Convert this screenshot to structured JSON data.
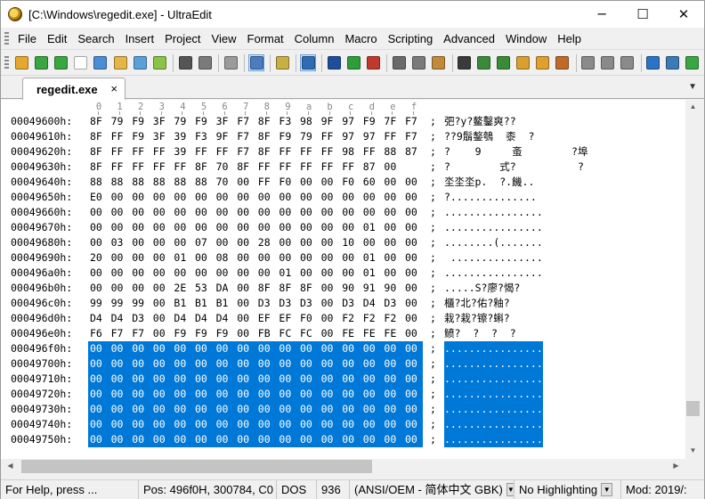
{
  "window": {
    "title": "[C:\\Windows\\regedit.exe] - UltraEdit",
    "minimize_glyph": "─",
    "maximize_glyph": "☐",
    "close_glyph": "✕"
  },
  "menu": [
    "File",
    "Edit",
    "Search",
    "Insert",
    "Project",
    "View",
    "Format",
    "Column",
    "Macro",
    "Scripting",
    "Advanced",
    "Window",
    "Help"
  ],
  "toolbar": {
    "icons": [
      {
        "name": "open-folder-icon",
        "color": "#e6a82e"
      },
      {
        "name": "back-arrow-icon",
        "color": "#3aa641"
      },
      {
        "name": "forward-arrow-icon",
        "color": "#3aa641"
      },
      {
        "name": "new-file-icon",
        "color": "#ffffff"
      },
      {
        "name": "open-file-icon",
        "color": "#4a8cd6"
      },
      {
        "name": "open-folder-2-icon",
        "color": "#e6b548"
      },
      {
        "name": "save-icon",
        "color": "#5aa0d8"
      },
      {
        "name": "save-all-icon",
        "color": "#8bc34a"
      },
      {
        "name": "sep"
      },
      {
        "name": "print-icon",
        "color": "#555555"
      },
      {
        "name": "print-preview-icon",
        "color": "#7a7a7a"
      },
      {
        "name": "sep"
      },
      {
        "name": "document-icon",
        "color": "#9a9a9a"
      },
      {
        "name": "sep"
      },
      {
        "name": "hex-mode-icon",
        "color": "#4a7dc0",
        "pressed": true
      },
      {
        "name": "sep"
      },
      {
        "name": "column-mode-icon",
        "color": "#c8b042"
      },
      {
        "name": "sep"
      },
      {
        "name": "word-wrap-icon",
        "color": "#2e6db5",
        "pressed": true
      },
      {
        "name": "sep"
      },
      {
        "name": "ftp-back-icon",
        "color": "#1f4f9c"
      },
      {
        "name": "ftp-up-icon",
        "color": "#2e9e3a"
      },
      {
        "name": "ftp-stop-icon",
        "color": "#c0392b"
      },
      {
        "name": "sep"
      },
      {
        "name": "cut-icon",
        "color": "#6a6a6a"
      },
      {
        "name": "copy-icon",
        "color": "#7a7a7a"
      },
      {
        "name": "paste-icon",
        "color": "#c08a3a"
      },
      {
        "name": "sep"
      },
      {
        "name": "find-icon",
        "color": "#3a3a3a"
      },
      {
        "name": "find-prev-icon",
        "color": "#3a8a3a"
      },
      {
        "name": "find-next-icon",
        "color": "#3a8a3a"
      },
      {
        "name": "replace-icon",
        "color": "#d8a02e"
      },
      {
        "name": "find-in-files-icon",
        "color": "#e0a030"
      },
      {
        "name": "replace-in-files-icon",
        "color": "#c06a2a"
      },
      {
        "name": "sep"
      },
      {
        "name": "list-icon",
        "color": "#8a8a8a"
      },
      {
        "name": "tile-icon",
        "color": "#8a8a8a"
      },
      {
        "name": "cascade-icon",
        "color": "#8a8a8a"
      },
      {
        "name": "sep"
      },
      {
        "name": "browser-icon",
        "color": "#2d73c4"
      },
      {
        "name": "spell-icon",
        "color": "#3a7ab8"
      },
      {
        "name": "refresh-icon",
        "color": "#3aa641"
      }
    ]
  },
  "tab": {
    "label": "regedit.exe",
    "close": "×",
    "menu_arrow": "▼"
  },
  "ruler": [
    "0",
    "1",
    "2",
    "3",
    "4",
    "5",
    "6",
    "7",
    "8",
    "9",
    "a",
    "b",
    "c",
    "d",
    "e",
    "f"
  ],
  "rows": [
    {
      "addr": "00049600h:",
      "bytes": [
        "8F",
        "79",
        "F9",
        "3F",
        "79",
        "F9",
        "3F",
        "F7",
        "8F",
        "F3",
        "98",
        "9F",
        "97",
        "F9",
        "7F",
        "F7"
      ],
      "ascii": "; 弝?y?鳌鑿爽??"
    },
    {
      "addr": "00049610h:",
      "bytes": [
        "8F",
        "FF",
        "F9",
        "3F",
        "39",
        "F3",
        "9F",
        "F7",
        "8F",
        "F9",
        "79",
        "FF",
        "97",
        "97",
        "FF",
        "F7"
      ],
      "ascii": "; ??9鬅鏊鴮  桼  ?"
    },
    {
      "addr": "00049620h:",
      "bytes": [
        "8F",
        "FF",
        "FF",
        "FF",
        "39",
        "FF",
        "FF",
        "F7",
        "8F",
        "FF",
        "FF",
        "FF",
        "98",
        "FF",
        "88",
        "87"
      ],
      "ascii": "; ?    9     蚉        ?埠"
    },
    {
      "addr": "00049630h:",
      "bytes": [
        "8F",
        "FF",
        "FF",
        "FF",
        "FF",
        "8F",
        "70",
        "8F",
        "FF",
        "FF",
        "FF",
        "FF",
        "FF",
        "87",
        "00"
      ],
      "ascii": "; ?        式?          ?"
    },
    {
      "addr": "00049640h:",
      "bytes": [
        "88",
        "88",
        "88",
        "88",
        "88",
        "88",
        "70",
        "00",
        "FF",
        "F0",
        "00",
        "00",
        "F0",
        "60",
        "00",
        "00"
      ],
      "ascii": "; 坔坔坔p.  ?.饑.."
    },
    {
      "addr": "00049650h:",
      "bytes": [
        "E0",
        "00",
        "00",
        "00",
        "00",
        "00",
        "00",
        "00",
        "00",
        "00",
        "00",
        "00",
        "00",
        "00",
        "00",
        "00"
      ],
      "ascii": "; ?.............."
    },
    {
      "addr": "00049660h:",
      "bytes": [
        "00",
        "00",
        "00",
        "00",
        "00",
        "00",
        "00",
        "00",
        "00",
        "00",
        "00",
        "00",
        "00",
        "00",
        "00",
        "00"
      ],
      "ascii": "; ................"
    },
    {
      "addr": "00049670h:",
      "bytes": [
        "00",
        "00",
        "00",
        "00",
        "00",
        "00",
        "00",
        "00",
        "00",
        "00",
        "00",
        "00",
        "00",
        "01",
        "00",
        "00"
      ],
      "ascii": "; ................"
    },
    {
      "addr": "00049680h:",
      "bytes": [
        "00",
        "03",
        "00",
        "00",
        "00",
        "07",
        "00",
        "00",
        "28",
        "00",
        "00",
        "00",
        "10",
        "00",
        "00",
        "00"
      ],
      "ascii": "; ........(......."
    },
    {
      "addr": "00049690h:",
      "bytes": [
        "20",
        "00",
        "00",
        "00",
        "01",
        "00",
        "08",
        "00",
        "00",
        "00",
        "00",
        "00",
        "00",
        "01",
        "00",
        "00"
      ],
      "ascii": ";  ..............."
    },
    {
      "addr": "000496a0h:",
      "bytes": [
        "00",
        "00",
        "00",
        "00",
        "00",
        "00",
        "00",
        "00",
        "00",
        "01",
        "00",
        "00",
        "00",
        "01",
        "00",
        "00"
      ],
      "ascii": "; ................"
    },
    {
      "addr": "000496b0h:",
      "bytes": [
        "00",
        "00",
        "00",
        "00",
        "2E",
        "53",
        "DA",
        "00",
        "8F",
        "8F",
        "8F",
        "00",
        "90",
        "91",
        "90",
        "00"
      ],
      "ascii": "; .....S?廖?愒?"
    },
    {
      "addr": "000496c0h:",
      "bytes": [
        "99",
        "99",
        "99",
        "00",
        "B1",
        "B1",
        "B1",
        "00",
        "D3",
        "D3",
        "D3",
        "00",
        "D3",
        "D4",
        "D3",
        "00"
      ],
      "ascii": "; 櫃?北?佑?釉?"
    },
    {
      "addr": "000496d0h:",
      "bytes": [
        "D4",
        "D4",
        "D3",
        "00",
        "D4",
        "D4",
        "D4",
        "00",
        "EF",
        "EF",
        "F0",
        "00",
        "F2",
        "F2",
        "F2",
        "00"
      ],
      "ascii": "; 栽?栽?镲?蝌?"
    },
    {
      "addr": "000496e0h:",
      "bytes": [
        "F6",
        "F7",
        "F7",
        "00",
        "F9",
        "F9",
        "F9",
        "00",
        "FB",
        "FC",
        "FC",
        "00",
        "FE",
        "FE",
        "FE",
        "00"
      ],
      "ascii": "; 鲼?  ?  ?  ?"
    },
    {
      "addr": "000496f0h:",
      "bytes": [
        "00",
        "00",
        "00",
        "00",
        "00",
        "00",
        "00",
        "00",
        "00",
        "00",
        "00",
        "00",
        "00",
        "00",
        "00",
        "00"
      ],
      "ascii": "; ................",
      "selected": true
    },
    {
      "addr": "00049700h:",
      "bytes": [
        "00",
        "00",
        "00",
        "00",
        "00",
        "00",
        "00",
        "00",
        "00",
        "00",
        "00",
        "00",
        "00",
        "00",
        "00",
        "00"
      ],
      "ascii": "; ................",
      "selected": true
    },
    {
      "addr": "00049710h:",
      "bytes": [
        "00",
        "00",
        "00",
        "00",
        "00",
        "00",
        "00",
        "00",
        "00",
        "00",
        "00",
        "00",
        "00",
        "00",
        "00",
        "00"
      ],
      "ascii": "; ................",
      "selected": true
    },
    {
      "addr": "00049720h:",
      "bytes": [
        "00",
        "00",
        "00",
        "00",
        "00",
        "00",
        "00",
        "00",
        "00",
        "00",
        "00",
        "00",
        "00",
        "00",
        "00",
        "00"
      ],
      "ascii": "; ................",
      "selected": true
    },
    {
      "addr": "00049730h:",
      "bytes": [
        "00",
        "00",
        "00",
        "00",
        "00",
        "00",
        "00",
        "00",
        "00",
        "00",
        "00",
        "00",
        "00",
        "00",
        "00",
        "00"
      ],
      "ascii": "; ................",
      "selected": true
    },
    {
      "addr": "00049740h:",
      "bytes": [
        "00",
        "00",
        "00",
        "00",
        "00",
        "00",
        "00",
        "00",
        "00",
        "00",
        "00",
        "00",
        "00",
        "00",
        "00",
        "00"
      ],
      "ascii": "; ................",
      "selected": true
    },
    {
      "addr": "00049750h:",
      "bytes": [
        "00",
        "00",
        "00",
        "00",
        "00",
        "00",
        "00",
        "00",
        "00",
        "00",
        "00",
        "00",
        "00",
        "00",
        "00",
        "00"
      ],
      "ascii": "; ................",
      "selected": true
    }
  ],
  "scroll": {
    "up": "▲",
    "down": "▼",
    "left": "◀",
    "right": "▶"
  },
  "status": {
    "help": "For Help, press ...",
    "position": "Pos: 496f0H, 300784, C0",
    "line_ending": "DOS",
    "codepage_num": "936",
    "codepage_name": "(ANSI/OEM - 简体中文 GBK)",
    "highlighting": "No Highlighting",
    "modified": "Mod: 2019/:",
    "dropdown_glyph": "▼"
  },
  "colors": {
    "selection": "#0078d7",
    "selection_text": "#ffffff"
  }
}
